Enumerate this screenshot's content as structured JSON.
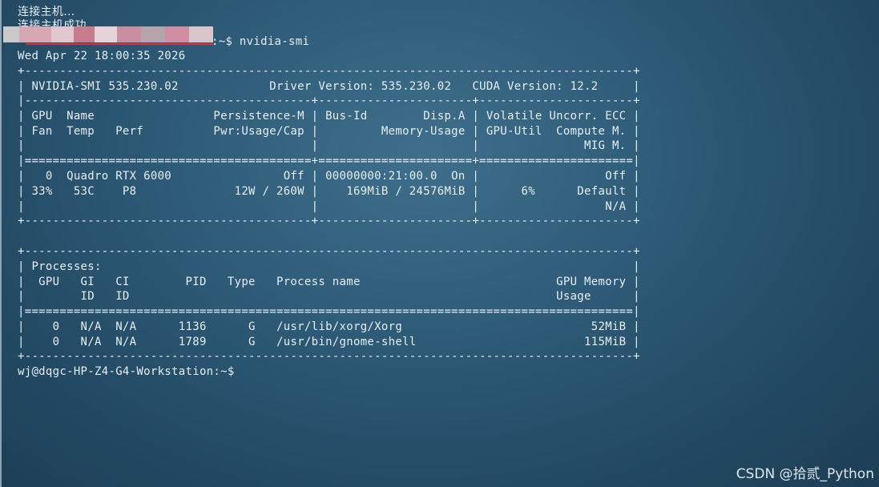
{
  "terminal": {
    "lines": [
      "连接主机...",
      "连接主机成功",
      ":~$ nvidia-smi",
      "Wed Apr 22 18:00:35 2026",
      "+---------------------------------------------------------------------------------------+",
      "| NVIDIA-SMI 535.230.02             Driver Version: 535.230.02   CUDA Version: 12.2     |",
      "|-----------------------------------------+----------------------+----------------------+",
      "| GPU  Name                 Persistence-M | Bus-Id        Disp.A | Volatile Uncorr. ECC |",
      "| Fan  Temp   Perf          Pwr:Usage/Cap |         Memory-Usage | GPU-Util  Compute M. |",
      "|                                         |                      |               MIG M. |",
      "|=========================================+======================+======================|",
      "|   0  Quadro RTX 6000                Off | 00000000:21:00.0  On |                  Off |",
      "| 33%   53C    P8              12W / 260W |    169MiB / 24576MiB |      6%      Default |",
      "|                                         |                      |                  N/A |",
      "+-----------------------------------------+----------------------+----------------------+",
      "",
      "+---------------------------------------------------------------------------------------+",
      "| Processes:                                                                            |",
      "|  GPU   GI   CI        PID   Type   Process name                            GPU Memory |",
      "|        ID   ID                                                             Usage      |",
      "|=======================================================================================|",
      "|    0   N/A  N/A      1136      G   /usr/lib/xorg/Xorg                           52MiB |",
      "|    0   N/A  N/A      1789      G   /usr/bin/gnome-shell                        115MiB |",
      "+---------------------------------------------------------------------------------------+",
      "wj@dqgc-HP-Z4-G4-Workstation:~$"
    ]
  },
  "watermark": "CSDN @拾贰_Python",
  "colors": {
    "background": "#2f5d7a",
    "text": "#e6eef4",
    "redaction_gray": "#c8c8c8",
    "redaction_red": "#e0303c"
  }
}
